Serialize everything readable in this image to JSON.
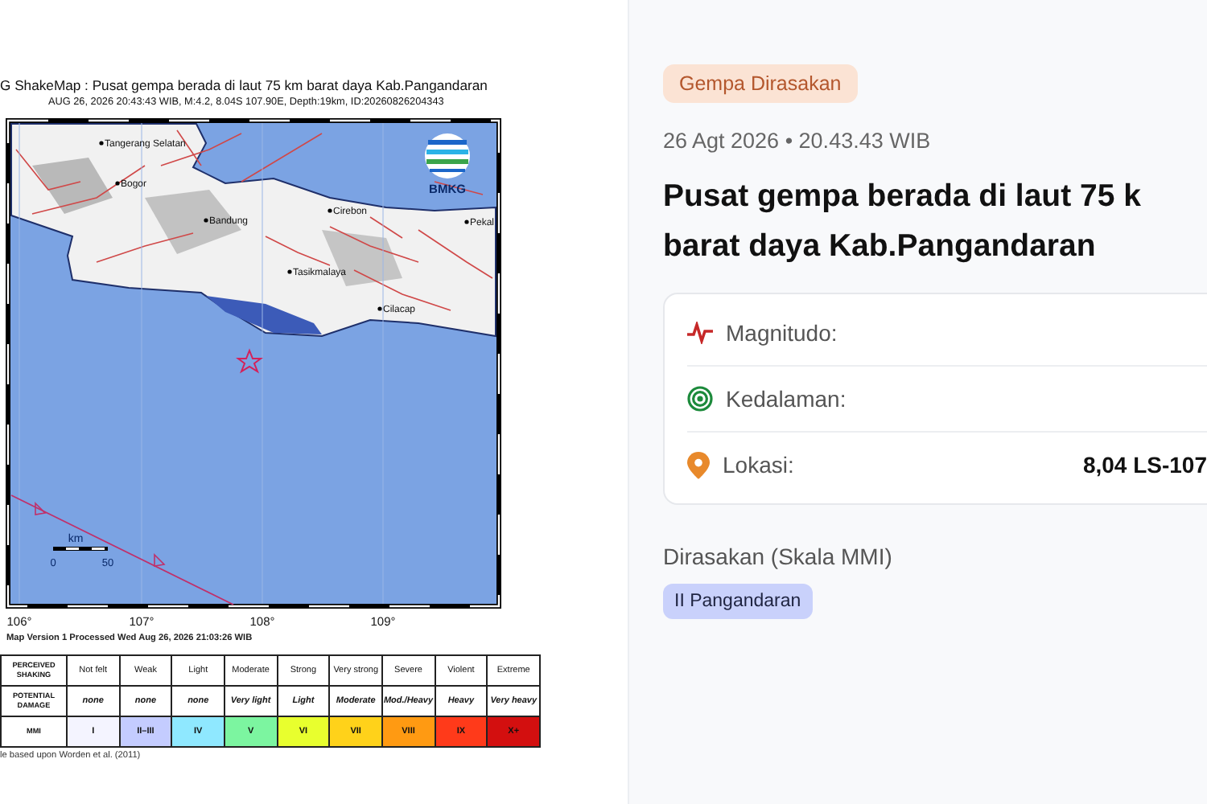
{
  "shakemap": {
    "title": "G ShakeMap : Pusat gempa berada di laut 75 km barat daya Kab.Pangandaran",
    "subtitle": "AUG 26, 2026 20:43:43 WIB, M:4.2, 8.04S 107.90E, Depth:19km, ID:20260826204343",
    "logo_text": "BMKG",
    "places": [
      "Tangerang Selatan",
      "Bogor",
      "Bandung",
      "Cirebon",
      "Tasikmalaya",
      "Cilacap",
      "Pekal"
    ],
    "scale": {
      "unit": "km",
      "start": "0",
      "end": "50"
    },
    "lon_ticks": [
      "106°",
      "107°",
      "108°",
      "109°"
    ],
    "version": "Map Version 1 Processed Wed Aug 26, 2026 21:03:26 WIB",
    "legend": {
      "row_labels": [
        "PERCEIVED SHAKING",
        "POTENTIAL DAMAGE",
        "MMI"
      ],
      "columns": [
        {
          "shaking": "Not felt",
          "damage": "none",
          "mmi": "I",
          "color": "#f4f4ff"
        },
        {
          "shaking": "Weak",
          "damage": "none",
          "mmi": "II–III",
          "color": "#c4ccff"
        },
        {
          "shaking": "Light",
          "damage": "none",
          "mmi": "IV",
          "color": "#8fe8ff"
        },
        {
          "shaking": "Moderate",
          "damage": "Very light",
          "mmi": "V",
          "color": "#7cf5a0"
        },
        {
          "shaking": "Strong",
          "damage": "Light",
          "mmi": "VI",
          "color": "#e8ff2e"
        },
        {
          "shaking": "Very strong",
          "damage": "Moderate",
          "mmi": "VII",
          "color": "#ffd21a"
        },
        {
          "shaking": "Severe",
          "damage": "Mod./Heavy",
          "mmi": "VIII",
          "color": "#ff9a12"
        },
        {
          "shaking": "Violent",
          "damage": "Heavy",
          "mmi": "IX",
          "color": "#ff3a1a"
        },
        {
          "shaking": "Extreme",
          "damage": "Very heavy",
          "mmi": "X+",
          "color": "#d30f0f"
        }
      ]
    },
    "footnote": "le based upon Worden et al. (2011)"
  },
  "info": {
    "badge": "Gempa Dirasakan",
    "date": "26 Agt 2026 • 20.43.43 WIB",
    "title_lines": [
      "Pusat gempa berada di laut 75 k",
      "barat daya Kab.Pangandaran"
    ],
    "details": [
      {
        "kind": "magnitude",
        "label": "Magnitudo:"
      },
      {
        "kind": "depth",
        "label": "Kedalaman:"
      },
      {
        "kind": "location",
        "label": "Lokasi:",
        "value": "8,04 LS-107"
      }
    ],
    "felt_label": "Dirasakan (Skala MMI)",
    "felt_regions": [
      "II Pangandaran"
    ]
  }
}
